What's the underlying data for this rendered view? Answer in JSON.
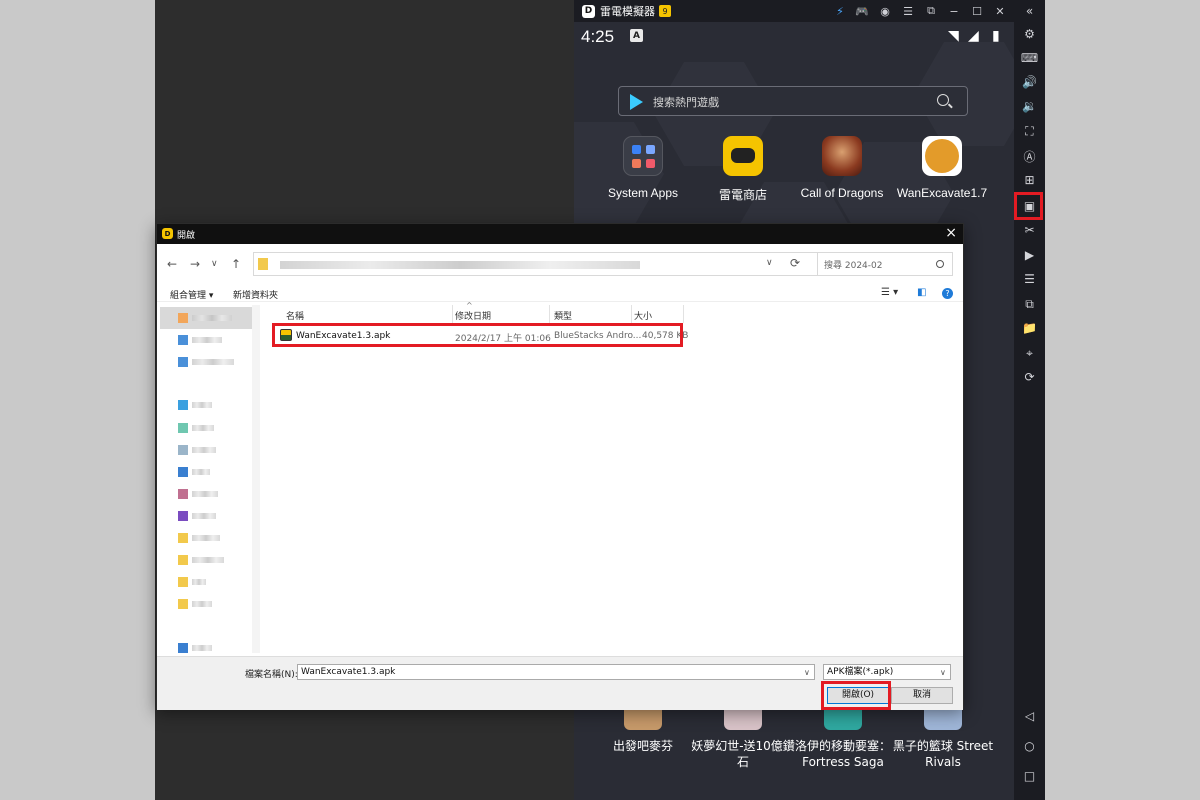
{
  "emulator": {
    "title": "雷電模擬器",
    "time": "4:25",
    "search_placeholder": "搜索熱門遊戲",
    "apps": [
      {
        "label": "System Apps"
      },
      {
        "label": "雷電商店"
      },
      {
        "label": "Call of Dragons"
      },
      {
        "label": "WanExcavate1.7"
      }
    ],
    "bottom_apps": [
      {
        "label": "出發吧麥芬"
      },
      {
        "label": "妖夢幻世-送10億鑽石"
      },
      {
        "label": "洛伊的移動要塞：Fortress Saga"
      },
      {
        "label": "黑子的籃球 Street Rivals"
      }
    ]
  },
  "dialog": {
    "title": "開啟",
    "search_placeholder": "搜尋 2024-02",
    "organize_label": "組合管理 ▾",
    "new_folder_label": "新增資料夾",
    "columns": [
      "名稱",
      "修改日期",
      "類型",
      "大小"
    ],
    "file": {
      "name": "WanExcavate1.3.apk",
      "modified": "2024/2/17 上午 01:06",
      "type": "BlueStacks Andro...",
      "size": "40,578 KB"
    },
    "filename_label": "檔案名稱(N):",
    "filename_value": "WanExcavate1.3.apk",
    "file_type_filter": "APK檔案(*.apk)",
    "open_button": "開啟(O)",
    "cancel_button": "取消"
  },
  "colors": {
    "highlight": "#e31b23",
    "emulator_bg": "#2a2c35",
    "sidebar_bg": "#1b1c22",
    "accent_blue": "#0078d7"
  }
}
